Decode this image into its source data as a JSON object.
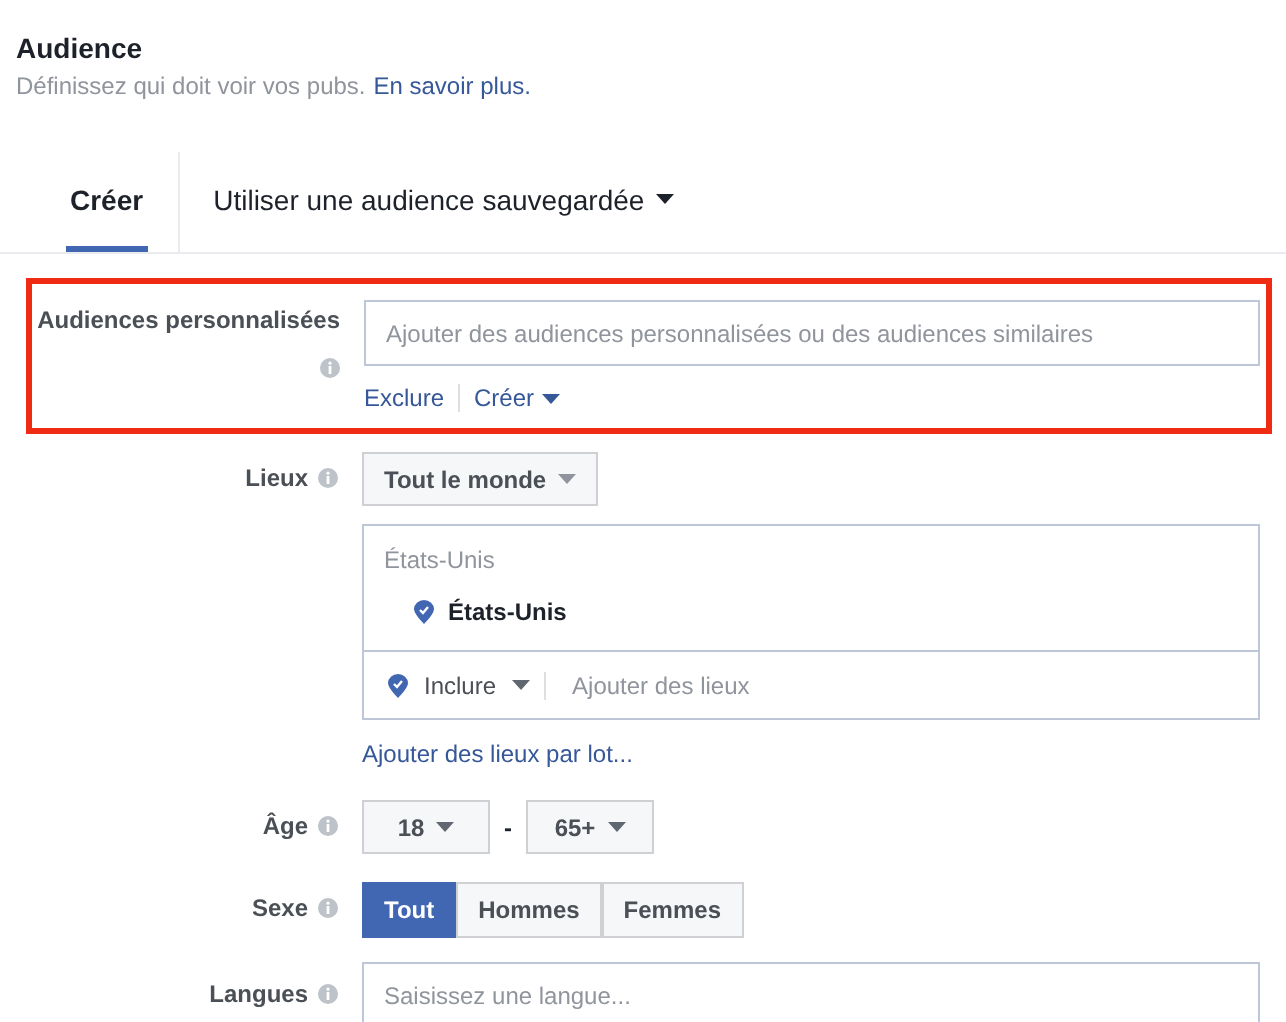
{
  "header": {
    "title": "Audience",
    "subtitle": "Définissez qui doit voir vos pubs.",
    "learn_more": "En savoir plus."
  },
  "tabs": [
    {
      "label": "Créer",
      "selected": true,
      "dropdown": false
    },
    {
      "label": "Utiliser une audience sauvegardée",
      "selected": false,
      "dropdown": true
    }
  ],
  "custom_audiences": {
    "label": "Audiences personnalisées",
    "highlighted": true,
    "placeholder": "Ajouter des audiences personnalisées ou des audiences similaires",
    "links": [
      {
        "label": "Exclure",
        "dropdown": false
      },
      {
        "label": "Créer",
        "dropdown": true
      }
    ]
  },
  "locations": {
    "label": "Lieux",
    "scope": "Tout le monde",
    "group_heading": "États-Unis",
    "items": [
      "États-Unis"
    ],
    "mode": "Inclure",
    "placeholder": "Ajouter des lieux",
    "bulk_link": "Ajouter des lieux par lot..."
  },
  "age": {
    "label": "Âge",
    "min": "18",
    "separator": "-",
    "max": "65+"
  },
  "gender": {
    "label": "Sexe",
    "options": [
      {
        "label": "Tout",
        "selected": true
      },
      {
        "label": "Hommes",
        "selected": false
      },
      {
        "label": "Femmes",
        "selected": false
      }
    ]
  },
  "languages": {
    "label": "Langues",
    "placeholder": "Saisissez une langue..."
  }
}
